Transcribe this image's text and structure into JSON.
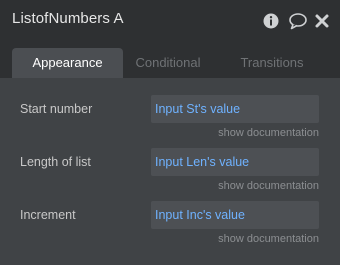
{
  "window": {
    "title": "ListofNumbers A"
  },
  "title_icons": {
    "info": "info-icon",
    "comment": "comment-icon",
    "close": "close-icon"
  },
  "tabs": [
    {
      "label": "Appearance",
      "active": true
    },
    {
      "label": "Conditional",
      "active": false
    },
    {
      "label": "Transitions",
      "active": false
    }
  ],
  "fields": [
    {
      "label": "Start number",
      "value": "Input St's value",
      "doc_link": "show documentation"
    },
    {
      "label": "Length of list",
      "value": "Input Len's value",
      "doc_link": "show documentation"
    },
    {
      "label": "Increment",
      "value": "Input Inc's value",
      "doc_link": "show documentation"
    }
  ],
  "colors": {
    "panel_bg": "#2e3032",
    "content_bg": "#404346",
    "active_tab_bg": "#4b4e52",
    "input_bg": "#4d5054",
    "dynamic_value_blue": "#6fb2ff",
    "inactive_tab_text": "#6f7275"
  }
}
